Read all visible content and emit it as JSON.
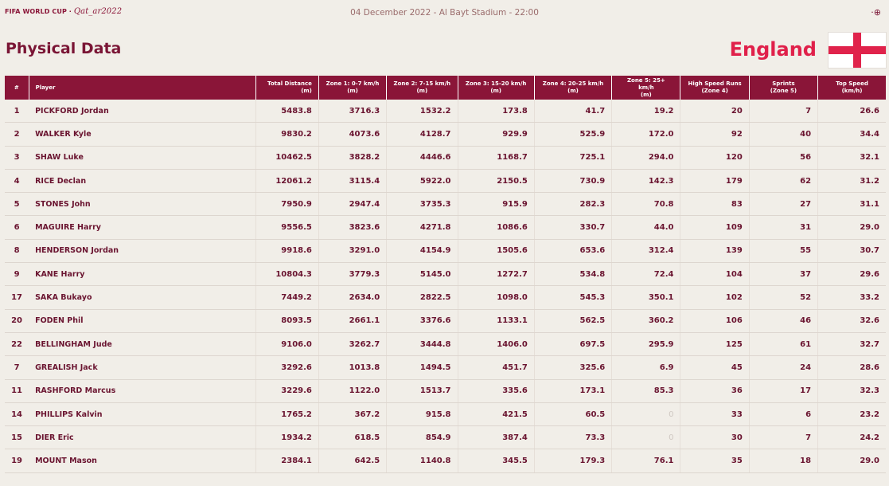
{
  "header": {
    "logo_text": "FIFA WORLD CUP",
    "logo_brand": "Qat_ar2022",
    "match_info": "04 December 2022 - Al Bayt Stadium - 22:00",
    "corner_icon": "settings-icon"
  },
  "page": {
    "title": "Physical Data",
    "team": "England",
    "flag": "england-flag"
  },
  "colors": {
    "primary": "#8a1538",
    "accent": "#e0204a",
    "background": "#f1eee8"
  },
  "table": {
    "columns": [
      {
        "line1": "#",
        "line2": ""
      },
      {
        "line1": "Player",
        "line2": ""
      },
      {
        "line1": "Total Distance",
        "line2": "(m)"
      },
      {
        "line1": "Zone 1: 0-7 km/h",
        "line2": "(m)"
      },
      {
        "line1": "Zone 2: 7-15 km/h",
        "line2": "(m)"
      },
      {
        "line1": "Zone 3: 15-20 km/h",
        "line2": "(m)"
      },
      {
        "line1": "Zone 4: 20-25 km/h",
        "line2": "(m)"
      },
      {
        "line1": "Zone 5: 25+ km/h",
        "line2": "(m)"
      },
      {
        "line1": "High Speed Runs",
        "line2": "(Zone 4)"
      },
      {
        "line1": "Sprints",
        "line2": "(Zone 5)"
      },
      {
        "line1": "Top Speed",
        "line2": "(km/h)"
      }
    ],
    "rows": [
      [
        "1",
        "PICKFORD Jordan",
        "5483.8",
        "3716.3",
        "1532.2",
        "173.8",
        "41.7",
        "19.2",
        "20",
        "7",
        "26.6"
      ],
      [
        "2",
        "WALKER Kyle",
        "9830.2",
        "4073.6",
        "4128.7",
        "929.9",
        "525.9",
        "172.0",
        "92",
        "40",
        "34.4"
      ],
      [
        "3",
        "SHAW Luke",
        "10462.5",
        "3828.2",
        "4446.6",
        "1168.7",
        "725.1",
        "294.0",
        "120",
        "56",
        "32.1"
      ],
      [
        "4",
        "RICE Declan",
        "12061.2",
        "3115.4",
        "5922.0",
        "2150.5",
        "730.9",
        "142.3",
        "179",
        "62",
        "31.2"
      ],
      [
        "5",
        "STONES John",
        "7950.9",
        "2947.4",
        "3735.3",
        "915.9",
        "282.3",
        "70.8",
        "83",
        "27",
        "31.1"
      ],
      [
        "6",
        "MAGUIRE Harry",
        "9556.5",
        "3823.6",
        "4271.8",
        "1086.6",
        "330.7",
        "44.0",
        "109",
        "31",
        "29.0"
      ],
      [
        "8",
        "HENDERSON Jordan",
        "9918.6",
        "3291.0",
        "4154.9",
        "1505.6",
        "653.6",
        "312.4",
        "139",
        "55",
        "30.7"
      ],
      [
        "9",
        "KANE Harry",
        "10804.3",
        "3779.3",
        "5145.0",
        "1272.7",
        "534.8",
        "72.4",
        "104",
        "37",
        "29.6"
      ],
      [
        "17",
        "SAKA Bukayo",
        "7449.2",
        "2634.0",
        "2822.5",
        "1098.0",
        "545.3",
        "350.1",
        "102",
        "52",
        "33.2"
      ],
      [
        "20",
        "FODEN Phil",
        "8093.5",
        "2661.1",
        "3376.6",
        "1133.1",
        "562.5",
        "360.2",
        "106",
        "46",
        "32.6"
      ],
      [
        "22",
        "BELLINGHAM Jude",
        "9106.0",
        "3262.7",
        "3444.8",
        "1406.0",
        "697.5",
        "295.9",
        "125",
        "61",
        "32.7"
      ],
      [
        "7",
        "GREALISH Jack",
        "3292.6",
        "1013.8",
        "1494.5",
        "451.7",
        "325.6",
        "6.9",
        "45",
        "24",
        "28.6"
      ],
      [
        "11",
        "RASHFORD Marcus",
        "3229.6",
        "1122.0",
        "1513.7",
        "335.6",
        "173.1",
        "85.3",
        "36",
        "17",
        "32.3"
      ],
      [
        "14",
        "PHILLIPS Kalvin",
        "1765.2",
        "367.2",
        "915.8",
        "421.5",
        "60.5",
        "0",
        "33",
        "6",
        "23.2"
      ],
      [
        "15",
        "DIER Eric",
        "1934.2",
        "618.5",
        "854.9",
        "387.4",
        "73.3",
        "0",
        "30",
        "7",
        "24.2"
      ],
      [
        "19",
        "MOUNT Mason",
        "2384.1",
        "642.5",
        "1140.8",
        "345.5",
        "179.3",
        "76.1",
        "35",
        "18",
        "29.0"
      ]
    ]
  }
}
